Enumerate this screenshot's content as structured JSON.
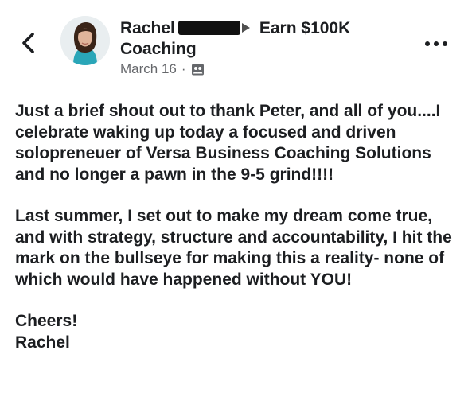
{
  "nav": {
    "back_icon": "chevron-left-icon",
    "more_icon": "more-horizontal-icon"
  },
  "post_header": {
    "author_first": "Rachel",
    "group_name_line1": "Earn $100K",
    "group_name_line2": "Coaching",
    "date": "March 16",
    "separator": "·",
    "audience_icon": "group-members-icon"
  },
  "post_body": {
    "paragraph1": "Just a brief shout out to thank Peter, and all of you....I celebrate waking up today a focused and driven solopreneuer of Versa Business Coaching Solutions and no longer a pawn in the 9-5 grind!!!!",
    "paragraph2": "Last summer, I set out to make my dream come true, and with strategy, structure and accountability, I hit the mark on the bullseye for making this a reality- none of which would have happened without YOU!",
    "signoff": "Cheers!",
    "signature": "Rachel"
  },
  "colors": {
    "text": "#1c1e21",
    "meta": "#65676b",
    "background": "#ffffff"
  }
}
